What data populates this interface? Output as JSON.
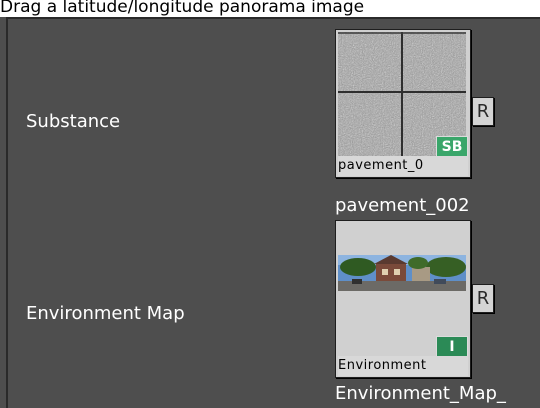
{
  "caption": "Drag a latitude/longitude panorama image",
  "rows": [
    {
      "label": "Substance",
      "thumb_label": "pavement_0",
      "badge": "SB",
      "badge_color": "#3aa66a",
      "reset_label": "R",
      "file_name": "pavement_002",
      "icon": "pavement-texture-icon"
    },
    {
      "label": "Environment Map",
      "thumb_label": "Environment",
      "badge": "I",
      "badge_color": "#2b8a56",
      "reset_label": "R",
      "file_name": "Environment_Map_",
      "icon": "panorama-image-icon"
    }
  ]
}
